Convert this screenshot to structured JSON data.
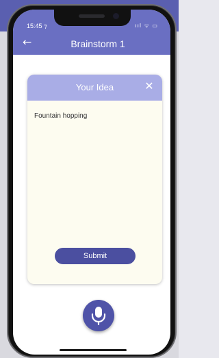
{
  "status_bar": {
    "time": "15:45 ⁊",
    "icons": "ııl ᯤ ▭"
  },
  "app_bar": {
    "title": "Brainstorm 1",
    "back_icon": "back-arrow-icon",
    "back_glyph": "←"
  },
  "dialog": {
    "title": "Your Idea",
    "close_glyph": "✕",
    "idea_text": "Fountain hopping",
    "submit_label": "Submit"
  },
  "mic": {
    "icon": "microphone-icon"
  },
  "colors": {
    "app_bar": "#6a6fc2",
    "card_header": "#a9ade6",
    "card_body": "#fdfcf0",
    "primary_button": "#4b4fa0"
  }
}
